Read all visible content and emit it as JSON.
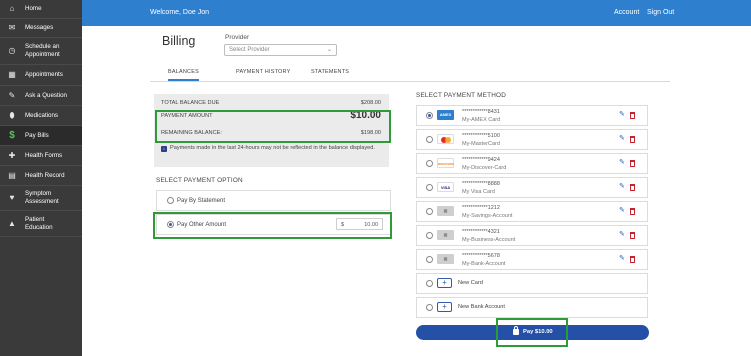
{
  "sidebar": {
    "items": [
      {
        "label": "Home",
        "icon": "home-icon",
        "glyph": "⌂"
      },
      {
        "label": "Messages",
        "icon": "envelope-icon",
        "glyph": "✉"
      },
      {
        "label": "Schedule an Appointment",
        "icon": "clock-icon",
        "glyph": "◷"
      },
      {
        "label": "Appointments",
        "icon": "calendar-icon",
        "glyph": "▦"
      },
      {
        "label": "Ask a Question",
        "icon": "chat-icon",
        "glyph": "✎"
      },
      {
        "label": "Medications",
        "icon": "pill-icon",
        "glyph": "⬮"
      },
      {
        "label": "Pay Bills",
        "icon": "dollar-icon",
        "glyph": "$"
      },
      {
        "label": "Health Forms",
        "icon": "plus-icon",
        "glyph": "✚"
      },
      {
        "label": "Health Record",
        "icon": "folder-icon",
        "glyph": "▤"
      },
      {
        "label": "Symptom Assessment",
        "icon": "heart-icon",
        "glyph": "♥"
      },
      {
        "label": "Patient Education",
        "icon": "graduation-cap-icon",
        "glyph": "▲"
      }
    ],
    "active_color": "#5fc15f"
  },
  "header": {
    "welcome": "Welcome, Doe Jon",
    "account": "Account",
    "signout": "Sign Out",
    "color": "#2f7fcf"
  },
  "billing": {
    "title": "Billing",
    "provider_label": "Provider",
    "provider_placeholder": "Select Provider"
  },
  "tabs": [
    "BALANCES",
    "PAYMENT HISTORY",
    "STATEMENTS"
  ],
  "balance": {
    "total_label": "TOTAL BALANCE DUE",
    "total_value": "$208.00",
    "payment_label": "PAYMENT AMOUNT",
    "payment_value": "$10.00",
    "remaining_label": "REMAINING BALANCE:",
    "remaining_value": "$198.00",
    "note": "Payments made in the last 24-hours may not be reflected in the balance displayed."
  },
  "payment_option": {
    "title": "SELECT PAYMENT OPTION",
    "by_statement": "Pay By Statement",
    "other_amount": "Pay Other Amount",
    "currency": "$",
    "amount": "10.00"
  },
  "payment_method": {
    "title": "SELECT PAYMENT METHOD",
    "methods": [
      {
        "number": "************8431",
        "name": "My-AMEX Card",
        "logo": "amex-logo",
        "logo_text": "AMEX"
      },
      {
        "number": "************5100",
        "name": "My-MasterCard",
        "logo": "mastercard-logo",
        "logo_text": ""
      },
      {
        "number": "************9424",
        "name": "My-Discover-Card",
        "logo": "discover-logo",
        "logo_text": "DISCOVER"
      },
      {
        "number": "************8888",
        "name": "My Visa Card",
        "logo": "visa-logo",
        "logo_text": "VISA"
      },
      {
        "number": "************1212",
        "name": "My-Savings-Account",
        "logo": "bank-logo",
        "logo_text": ""
      },
      {
        "number": "************4321",
        "name": "My-Business-Account",
        "logo": "bank-logo",
        "logo_text": ""
      },
      {
        "number": "************5678",
        "name": "My-Bank-Account",
        "logo": "bank-logo",
        "logo_text": ""
      }
    ],
    "new_card": "New Card",
    "new_bank": "New Bank Account"
  },
  "pay_button": {
    "label": "Pay $10.00",
    "color": "#2450a8"
  },
  "highlight_color": "#2e9a38"
}
